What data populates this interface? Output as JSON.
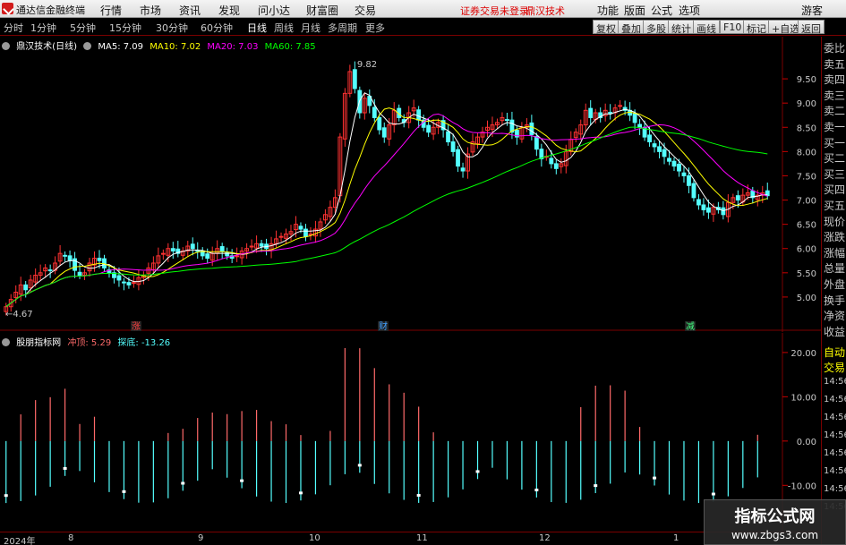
{
  "app": {
    "title": "通达信金融终端",
    "menus": [
      "行情",
      "市场",
      "资讯",
      "发现",
      "问小达",
      "财富圈",
      "交易"
    ],
    "status_login": "证券交易未登录",
    "status_name": "鼎汉技术",
    "right_menus": [
      "功能",
      "版面",
      "公式",
      "选项"
    ],
    "guest": "游客"
  },
  "toolbar": {
    "periods": [
      "分时",
      "1分钟",
      "5分钟",
      "15分钟",
      "30分钟",
      "60分钟",
      "日线",
      "周线",
      "月线",
      "多周期",
      "更多"
    ],
    "active_period": "日线",
    "buttons": [
      "复权",
      "叠加",
      "多股",
      "统计",
      "画线",
      "F10",
      "标记",
      "+自选",
      "返回"
    ]
  },
  "main_legend": {
    "title": "鼎汉技术(日线)",
    "ma5": "MA5: 7.09",
    "ma10": "MA10: 7.02",
    "ma20": "MA20: 7.03",
    "ma60": "MA60: 7.85",
    "colors": {
      "ma5": "#ffffff",
      "ma10": "#ffff00",
      "ma20": "#ff00ff",
      "ma60": "#00ff00"
    }
  },
  "sub_legend": {
    "title": "股朋指标网",
    "chongding": "冲顶: 5.29",
    "tandi": "探底: -13.26"
  },
  "price_axis": [
    "9.50",
    "9.00",
    "8.50",
    "8.00",
    "7.50",
    "7.00",
    "6.50",
    "6.00",
    "5.50",
    "5.00"
  ],
  "sub_axis": [
    "20.00",
    "10.00",
    "0.00",
    "-10.00"
  ],
  "annotations": {
    "high": "9.82",
    "low": "4.67",
    "markers": [
      "涨",
      "财",
      "减"
    ]
  },
  "dates": [
    "2024年",
    "8",
    "9",
    "10",
    "11",
    "12",
    "1"
  ],
  "side_panel": {
    "quote_labels": [
      "委比",
      "卖五",
      "卖四",
      "卖三",
      "卖二",
      "卖一",
      "买一",
      "买二",
      "买三",
      "买四",
      "买五",
      "现价",
      "涨跌",
      "涨幅",
      "总量",
      "外盘",
      "换手",
      "净资",
      "收益"
    ],
    "trade_labels": [
      "自动",
      "交易"
    ],
    "times": [
      "14:56",
      "14:56",
      "14:56",
      "14:56",
      "14:56",
      "14:56",
      "14:56",
      "14:56"
    ]
  },
  "watermark": {
    "line1": "指标公式网",
    "line2": "www.zbgs3.com"
  },
  "chart_data": [
    {
      "type": "candlestick",
      "title": "鼎汉技术(日线)",
      "ylim": [
        4.5,
        10.0
      ],
      "up_color": "#ff3232",
      "down_color": "#54ffff",
      "closes": [
        4.8,
        4.95,
        5.1,
        5.25,
        5.15,
        5.35,
        5.45,
        5.5,
        5.6,
        5.55,
        5.7,
        5.9,
        5.85,
        5.75,
        5.55,
        5.45,
        5.5,
        5.7,
        5.8,
        5.75,
        5.6,
        5.5,
        5.4,
        5.35,
        5.3,
        5.25,
        5.3,
        5.4,
        5.45,
        5.6,
        5.7,
        5.85,
        5.9,
        6.0,
        5.95,
        5.9,
        5.95,
        6.05,
        6.0,
        5.95,
        5.85,
        5.8,
        5.9,
        6.0,
        5.95,
        5.85,
        5.8,
        5.85,
        5.95,
        6.0,
        6.05,
        6.1,
        6.05,
        6.0,
        6.1,
        6.2,
        6.25,
        6.3,
        6.35,
        6.5,
        6.4,
        6.25,
        6.3,
        6.4,
        6.55,
        6.7,
        6.85,
        7.05,
        8.3,
        9.2,
        9.65,
        9.3,
        8.8,
        9.1,
        8.95,
        8.7,
        8.45,
        8.3,
        8.55,
        8.85,
        8.7,
        8.6,
        8.8,
        8.9,
        8.65,
        8.5,
        8.4,
        8.5,
        8.6,
        8.45,
        8.2,
        8.0,
        7.7,
        7.6,
        7.95,
        8.2,
        8.3,
        8.4,
        8.5,
        8.55,
        8.6,
        8.7,
        8.65,
        8.4,
        8.3,
        8.5,
        8.55,
        8.35,
        8.05,
        7.85,
        7.9,
        7.75,
        7.65,
        7.75,
        8.0,
        8.25,
        8.4,
        8.55,
        8.85,
        8.7,
        8.8,
        8.7,
        8.85,
        8.8,
        8.9,
        8.95,
        8.85,
        8.75,
        8.6,
        8.5,
        8.3,
        8.2,
        8.1,
        8.0,
        7.9,
        7.8,
        7.7,
        7.6,
        7.5,
        7.3,
        7.05,
        6.9,
        6.8,
        6.75,
        6.85,
        6.8,
        6.7,
        6.95,
        7.05,
        7.0,
        7.1,
        7.15,
        7.05,
        7.1,
        7.15,
        7.09
      ],
      "ma5_last": 7.09,
      "ma10_last": 7.02,
      "ma20_last": 7.03,
      "ma60_last": 7.85,
      "high": 9.82,
      "low": 4.67
    },
    {
      "type": "bar",
      "title": "股朋指标网",
      "ylim": [
        -16,
        22
      ],
      "series": [
        {
          "name": "冲顶",
          "last": 5.29
        },
        {
          "name": "探底",
          "last": -13.26
        }
      ]
    }
  ]
}
